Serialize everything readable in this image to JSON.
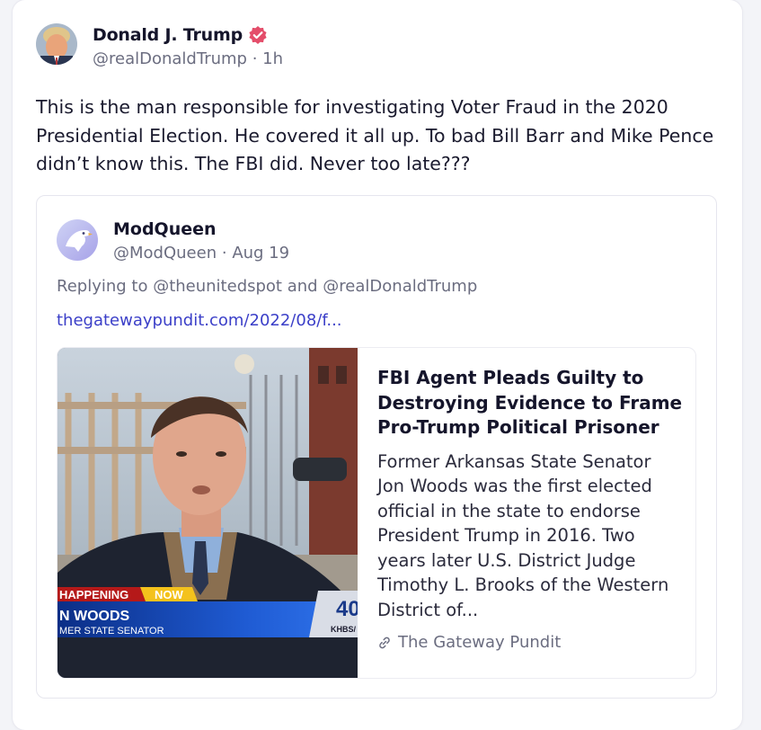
{
  "post": {
    "author_name": "Donald J. Trump",
    "handle": "@realDonaldTrump",
    "separator": "·",
    "time": "1h",
    "text": "This is the man responsible for investigating Voter Fraud in the 2020 Presidential Election. He covered it all up. To bad Bill Barr and Mike Pence didn’t know this. The FBI did. Never too late???",
    "verified_badge_icon": "verified-badge-icon",
    "accent_color": "#e44d6a"
  },
  "quote": {
    "author_name": "ModQueen",
    "handle": "@ModQueen",
    "separator": "·",
    "date": "Aug 19",
    "replying_to": "Replying to @theunitedspot and @realDonaldTrump",
    "link_text": "thegatewaypundit.com/2022/08/f...",
    "link_color": "#3b3fc8",
    "card": {
      "title": "FBI Agent Pleads Guilty to Destroying Evidence to Frame Pro-Trump Political Prisoner",
      "description": "Former Arkansas State Senator Jon Woods was the first elected official in the state to endorse President Trump in 2016. Two years later U.S. District Judge Timothy L. Brooks of the Western District of...",
      "source": "The Gateway Pundit",
      "source_icon": "link-icon",
      "thumbnail": {
        "banner_top": "HAPPENING",
        "banner_now": "NOW",
        "banner_name": "N WOODS",
        "banner_sub": "MER STATE SENATOR",
        "station_number": "40",
        "station_call": "KHBS/"
      }
    }
  }
}
